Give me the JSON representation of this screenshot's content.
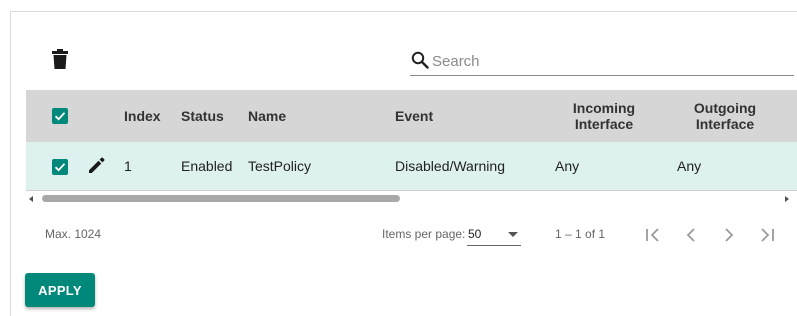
{
  "search": {
    "placeholder": "Search",
    "value": ""
  },
  "table": {
    "columns": {
      "index": "Index",
      "status": "Status",
      "name": "Name",
      "event": "Event",
      "incoming_line1": "Incoming",
      "incoming_line2": "Interface",
      "outgoing_line1": "Outgoing",
      "outgoing_line2": "Interface"
    },
    "rows": [
      {
        "index": "1",
        "status": "Enabled",
        "name": "TestPolicy",
        "event": "Disabled/Warning",
        "incoming": "Any",
        "outgoing": "Any",
        "selected": true
      }
    ],
    "header_selected": true
  },
  "footer": {
    "max": "Max. 1024",
    "items_per_page_label": "Items per page:",
    "items_per_page_value": "50",
    "range": "1 – 1 of 1"
  },
  "apply_label": "APPLY",
  "icons": {
    "delete": "trash-icon",
    "edit": "pencil-icon",
    "search": "search-icon",
    "check": "checkbox-checked-icon",
    "first": "first-page-icon",
    "prev": "prev-page-icon",
    "next": "next-page-icon",
    "last": "last-page-icon"
  },
  "colors": {
    "accent": "#00897b",
    "header_bg": "#d6d6d6",
    "selected_row_bg": "#ddf1ef"
  }
}
